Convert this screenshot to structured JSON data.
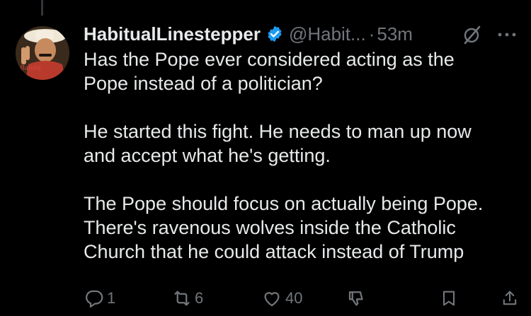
{
  "post": {
    "author": {
      "display_name": "HabitualLinestepper",
      "handle": "@Habit...",
      "verified": true,
      "avatar_icon": "avatar-photo"
    },
    "separator": "·",
    "time": "53m",
    "paragraphs": [
      "Has the Pope ever considered acting as the\nPope instead of a politician?",
      "He started this fight. He needs to man up now\nand accept what he's getting.",
      "The Pope should focus on actually being Pope.\nThere's ravenous wolves inside the Catholic\nChurch that he could attack instead of Trump"
    ],
    "actions": {
      "reply_count": "1",
      "repost_count": "6",
      "like_count": "40",
      "views_icon": "views-icon",
      "bookmark_icon": "bookmark-icon",
      "share_icon": "share-icon"
    }
  },
  "colors": {
    "background": "#000000",
    "text_primary": "#e7e9ea",
    "text_secondary": "#71767b",
    "verified_badge": "#1d9bf0"
  }
}
